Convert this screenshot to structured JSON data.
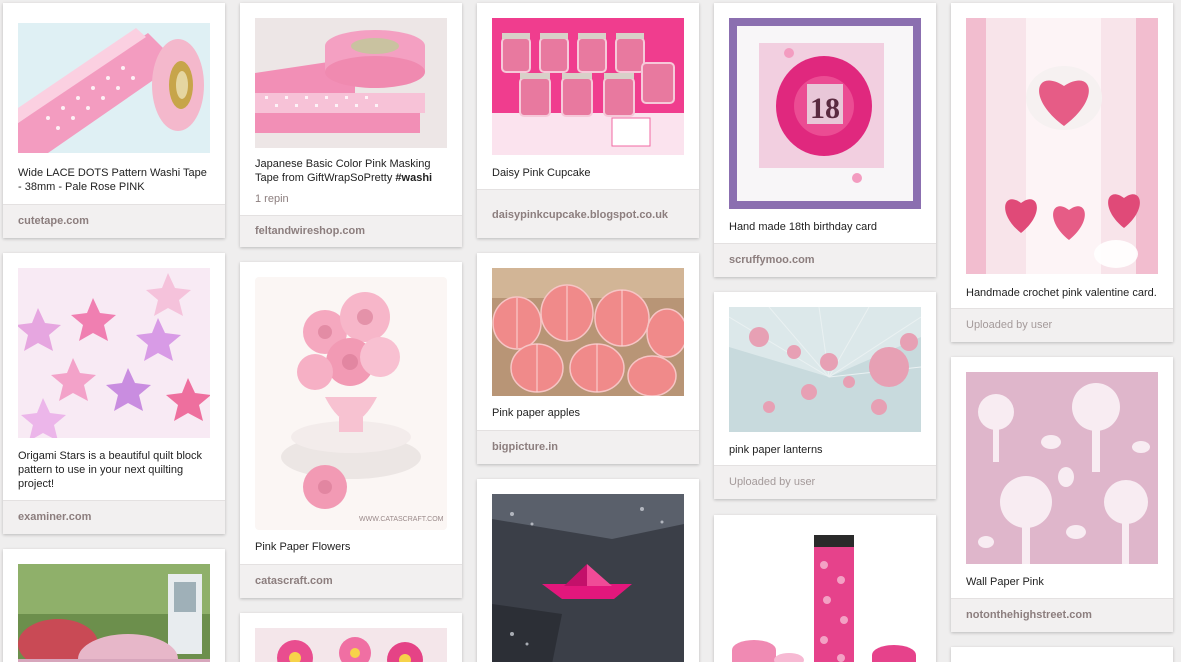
{
  "pins": [
    {
      "id": "washi-lace",
      "description": "Wide LACE DOTS Pattern Washi Tape - 38mm - Pale Rose PINK",
      "source": "cutetape.com"
    },
    {
      "id": "masking-tape",
      "description": "Japanese Basic Color Pink Masking Tape from GiftWrapSoPretty",
      "hashtag": "#washi",
      "repins": "1 repin",
      "source": "feltandwireshop.com"
    },
    {
      "id": "cupcake",
      "description": "Daisy Pink Cupcake",
      "source": "daisypinkcupcake.blogspot.co.uk"
    },
    {
      "id": "birthday-card",
      "description": "Hand made 18th birthday card",
      "card_number": "18",
      "source": "scruffymoo.com"
    },
    {
      "id": "crochet-card",
      "description": "Handmade crochet pink valentine card.",
      "source": "Uploaded by user"
    },
    {
      "id": "origami-stars",
      "description": "Origami Stars is a beautiful quilt block pattern to use in your next quilting project!",
      "source": "examiner.com"
    },
    {
      "id": "paper-flowers",
      "description": "Pink Paper Flowers",
      "watermark": "WWW.CATASCRAFT.COM",
      "source": "catascraft.com"
    },
    {
      "id": "paper-apples",
      "description": "Pink paper apples",
      "source": "bigpicture.in"
    },
    {
      "id": "paper-lanterns",
      "description": "pink paper lanterns",
      "source": "Uploaded by user"
    },
    {
      "id": "wallpaper",
      "description": "Wall Paper Pink",
      "source": "notonthehighstreet.com"
    },
    {
      "id": "garden",
      "description": "",
      "source": ""
    },
    {
      "id": "pink-flowers",
      "description": "",
      "source": ""
    },
    {
      "id": "paper-boat",
      "description": "",
      "source": ""
    },
    {
      "id": "pink-tape-rolls",
      "description": "",
      "source": ""
    }
  ]
}
